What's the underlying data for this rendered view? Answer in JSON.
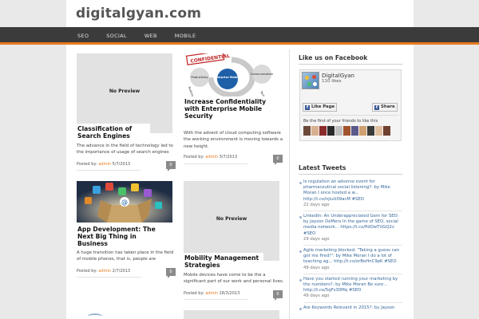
{
  "site": {
    "title": "digitalgyan.com"
  },
  "nav": {
    "items": [
      "SEO",
      "SOCIAL",
      "WEB",
      "MOBILE"
    ]
  },
  "posts": [
    {
      "title": "Classification of Search Engines",
      "excerpt": "The advance in the field of technology led to the importance of usage of search engines",
      "meta_prefix": "Posted by:",
      "author": "admin",
      "date": "5/7/2013",
      "comments": "0",
      "thumb_label": "No Preview"
    },
    {
      "title": "Increase Confidentiality with Enterprise Mobile Security",
      "excerpt": "With the advent of cloud computing software the working environment is moving towards a new height.",
      "meta_prefix": "Posted by:",
      "author": "admin",
      "date": "3/7/2013",
      "comments": "0",
      "thumb_labels": [
        "CONFIDENTIAL",
        "Productivity",
        "Enterprise Mobility",
        "Communication",
        "Technology",
        "Business"
      ]
    },
    {
      "title": "App Development: The Next Big Thing in Business",
      "excerpt": "A huge transition has taken place in the field of mobile phones, that is, people are",
      "meta_prefix": "Posted by:",
      "author": "admin",
      "date": "2/7/2013",
      "comments": "0"
    },
    {
      "title": "Mobility Management Strategies",
      "excerpt": "Mobile devices have come to be the a significant part of our work and personal lives.",
      "meta_prefix": "Posted by:",
      "author": "admin",
      "date": "18/3/2013",
      "comments": "0",
      "thumb_label": "No Preview"
    }
  ],
  "facebook": {
    "heading": "Like us on Facebook",
    "page_name": "DigitalGyan",
    "likes": "110 likes",
    "like_label": "Like Page",
    "share_label": "Share",
    "friends_text": "Be the first of your friends to like this"
  },
  "tweets": {
    "heading": "Latest Tweets",
    "items": [
      {
        "text": "Is regulation an adverse event for pharmaceutical social listening?: by Mike Moran I once hosted a w... http://t.co/njiuU09acM #SEO",
        "date": "22 days ago"
      },
      {
        "text": "LinkedIn: An Underappreciated Gem for SEO: by Jayson DeMers In the game of SEO, social media network... https://t.co/PdOwTUGQ2v #SEO",
        "date": "29 days ago"
      },
      {
        "text": "Agile marketing blocked: \"Taking a guess can get me fired!\": by Mike Moran I do a lot of teaching ag... http://t.co/orBoHnC9pK #SEO",
        "date": "49 days ago"
      },
      {
        "text": "Have you started running your marketing by the numbers?: by Mike Moran Be sure... http://t.co/5qFs30Mq #SEO",
        "date": "49 days ago"
      },
      {
        "text": "Are Keywords Relevant in 2015?: by Jayson",
        "date": ""
      }
    ]
  },
  "colors": {
    "accent": "#e87a1e",
    "nav_bg": "#3b3b3b",
    "link": "#336699",
    "page_bg": "#e9e9e9"
  }
}
